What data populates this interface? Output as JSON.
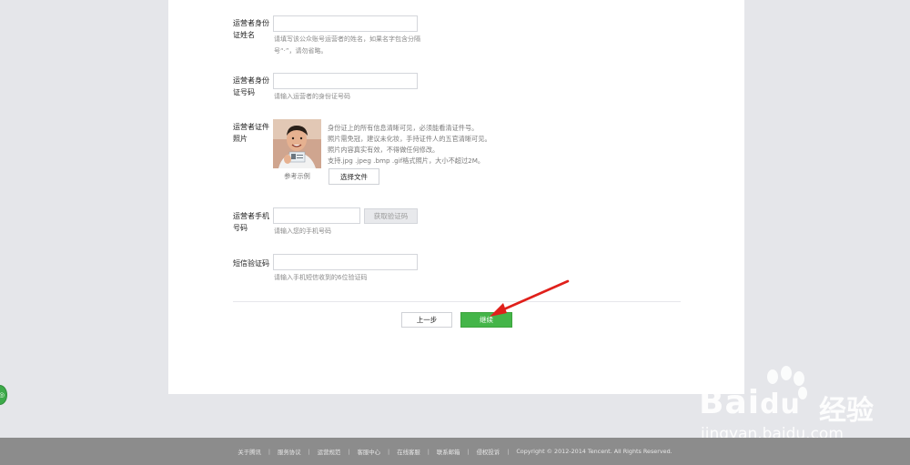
{
  "form": {
    "name_label": "运营者身份证姓名",
    "name_hint_1": "请填写该公众账号运营者的姓名，如果名字包含分隔",
    "name_hint_2": "号“·”，请勿省略。",
    "id_label": "运营者身份证号码",
    "id_hint": "请输入运营者的身份证号码",
    "photo_label": "运营者证件照片",
    "photo_desc": [
      "身份证上的所有信息清晰可见，必须能看清证件号。",
      "照片需免冠，建议未化妆，手持证件人的五官清晰可见。",
      "照片内容真实有效，不得做任何修改。",
      "支持.jpg .jpeg .bmp .gif格式照片，大小不超过2M。"
    ],
    "photo_caption": "参考示例",
    "choose_file": "选择文件",
    "phone_label": "运营者手机号码",
    "get_code": "获取验证码",
    "phone_hint": "请输入您的手机号码",
    "sms_label": "短信验证码",
    "sms_hint": "请输入手机短信收到的6位验证码"
  },
  "actions": {
    "prev": "上一步",
    "next": "继续"
  },
  "footer": {
    "links": [
      "关于腾讯",
      "服务协议",
      "运营规范",
      "客服中心",
      "在线客服",
      "联系邮箱",
      "侵权投诉"
    ],
    "copyright": "Copyright © 2012-2014 Tencent. All Rights Reserved."
  },
  "watermark": {
    "brand": "Bai",
    "brand_end": "du",
    "cn": "经验",
    "url": "jingyan.baidu.com"
  },
  "colors": {
    "primary_green": "#44b549",
    "arrow_red": "#e0201b"
  }
}
